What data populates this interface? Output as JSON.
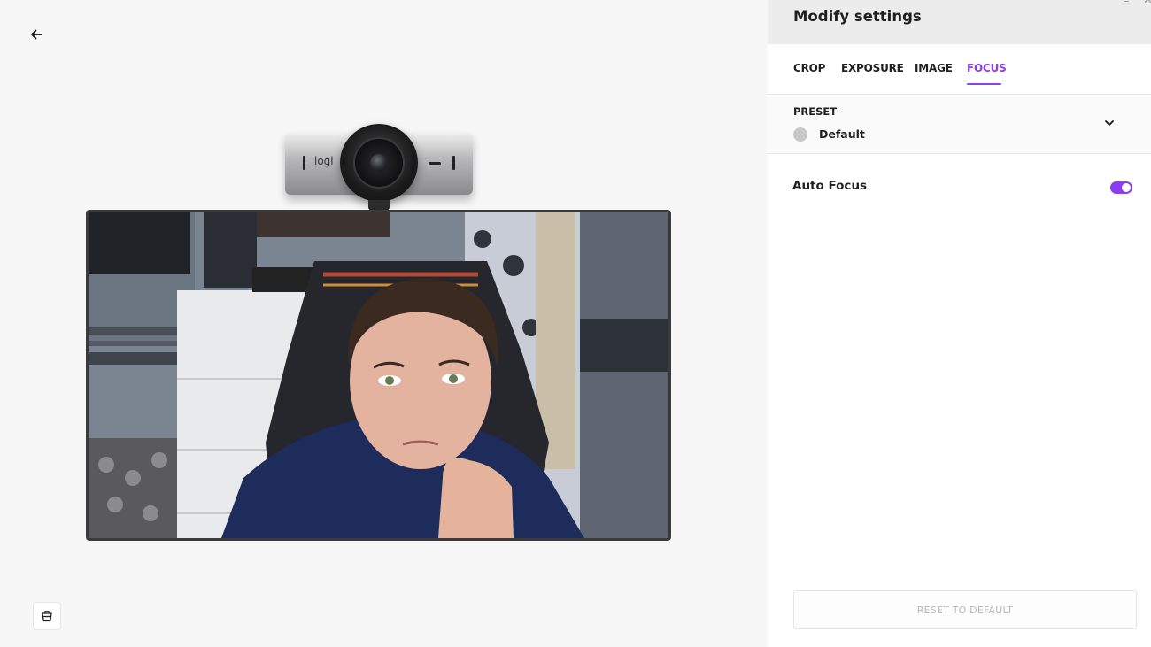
{
  "camera": {
    "brand_label": "logi"
  },
  "panel": {
    "title": "Modify settings",
    "window_controls": {
      "minimize": "–",
      "close": "✕"
    },
    "tabs": [
      {
        "label": "CROP",
        "active": false
      },
      {
        "label": "EXPOSURE",
        "active": false
      },
      {
        "label": "IMAGE",
        "active": false
      },
      {
        "label": "FOCUS",
        "active": true
      }
    ],
    "preset": {
      "label": "PRESET",
      "value": "Default"
    },
    "auto_focus": {
      "label": "Auto Focus",
      "enabled": true
    },
    "reset_label": "RESET TO DEFAULT"
  },
  "colors": {
    "accent": "#8a3df2",
    "panel_header_bg": "#ececec",
    "page_bg": "#f7f7f7"
  },
  "icons": {
    "back": "arrow-left-icon",
    "bottom_left": "basket-icon",
    "preset_chevron": "chevron-down-icon"
  }
}
